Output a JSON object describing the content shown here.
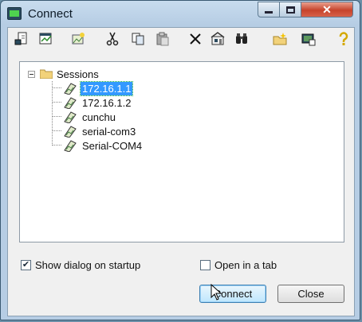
{
  "window": {
    "title": "Connect"
  },
  "titlebar_buttons": {
    "close": "✕"
  },
  "toolbar": [
    {
      "name": "quick-connect-icon"
    },
    {
      "name": "connect-in-tab-icon"
    },
    {
      "name": "new-session-icon"
    },
    {
      "name": "cut-icon"
    },
    {
      "name": "copy-icon"
    },
    {
      "name": "paste-icon"
    },
    {
      "name": "delete-icon"
    },
    {
      "name": "properties-icon"
    },
    {
      "name": "find-icon"
    },
    {
      "name": "new-folder-icon"
    },
    {
      "name": "desktop-shortcut-icon"
    },
    {
      "name": "help-icon"
    }
  ],
  "tree": {
    "root": "Sessions",
    "items": [
      {
        "label": "172.16.1.1",
        "selected": true
      },
      {
        "label": "172.16.1.2",
        "selected": false
      },
      {
        "label": "cunchu",
        "selected": false
      },
      {
        "label": "serial-com3",
        "selected": false
      },
      {
        "label": "Serial-COM4",
        "selected": false
      }
    ]
  },
  "options": {
    "show_dialog": {
      "label": "Show dialog on startup",
      "checked": true
    },
    "open_in_tab": {
      "label": "Open in a tab",
      "checked": false
    }
  },
  "buttons": {
    "connect": "Connect",
    "close": "Close"
  },
  "colors": {
    "selection": "#3399ff",
    "titlebar": "#b6cde4",
    "close_button": "#c6432b"
  }
}
